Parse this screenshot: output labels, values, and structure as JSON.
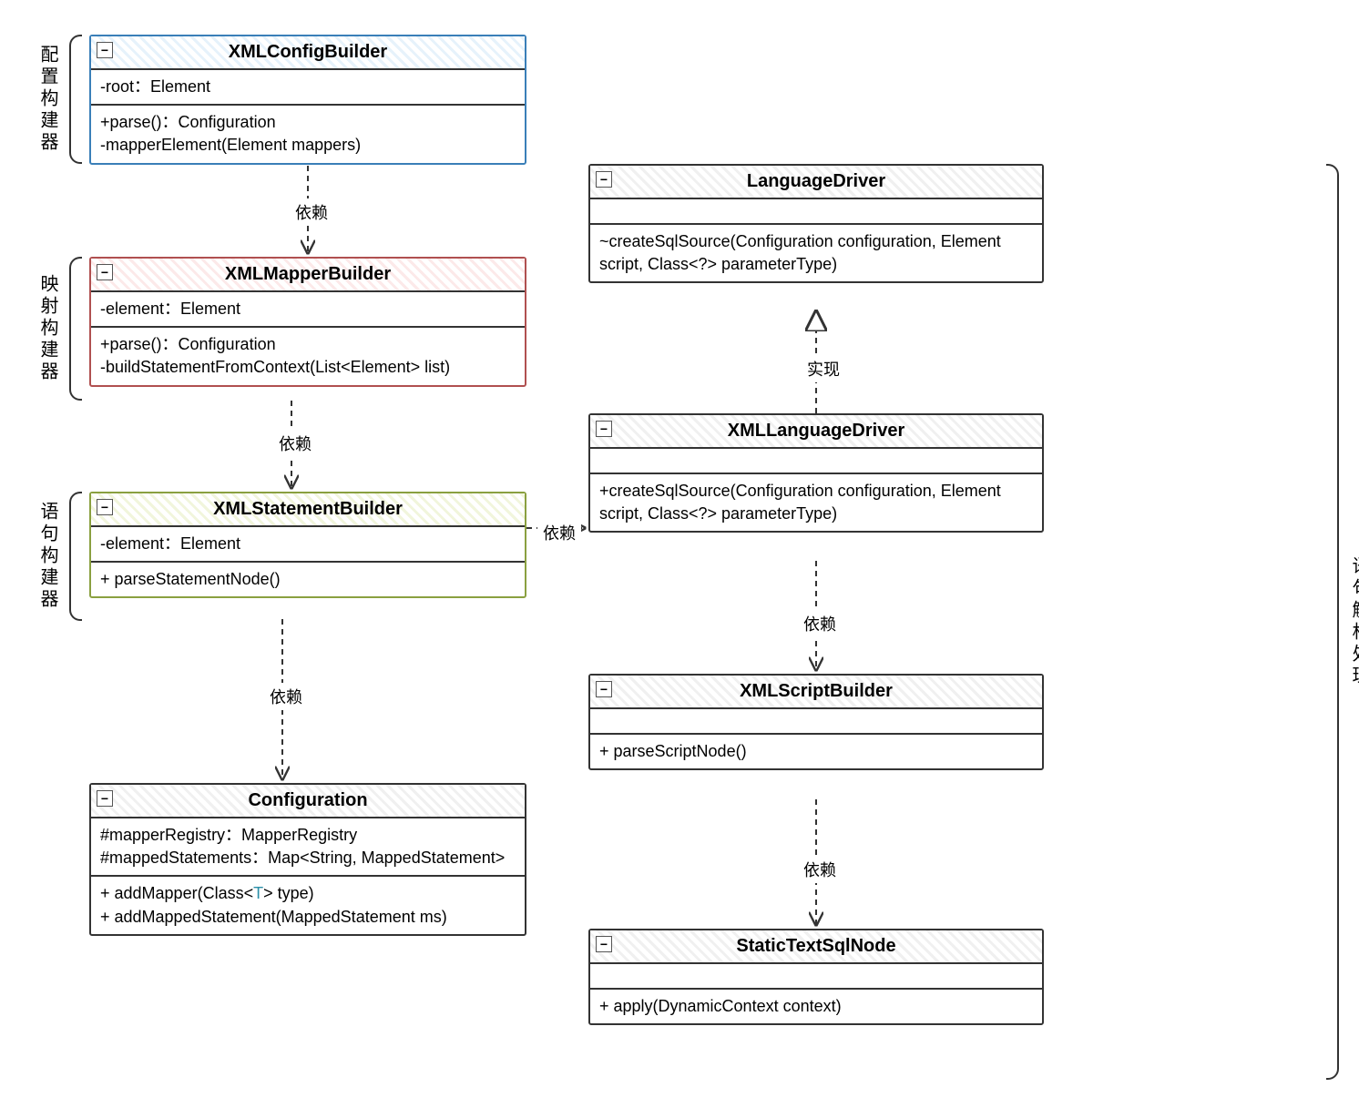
{
  "labels": {
    "group1": "配置构建器",
    "group2": "映射构建器",
    "group3": "语句构建器",
    "group4": "语句解析处理",
    "depend": "依赖",
    "realize": "实现"
  },
  "classes": {
    "xmlConfigBuilder": {
      "name": "XMLConfigBuilder",
      "attrs": "-root：Element",
      "ops1": "+parse()：Configuration",
      "ops2": "-mapperElement(Element mappers)"
    },
    "xmlMapperBuilder": {
      "name": "XMLMapperBuilder",
      "attrs": "-element：Element",
      "ops1": "+parse()：Configuration",
      "ops2": "-buildStatementFromContext(List<Element> list)"
    },
    "xmlStatementBuilder": {
      "name": "XMLStatementBuilder",
      "attrs": "-element：Element",
      "ops1": "+ parseStatementNode()"
    },
    "configuration": {
      "name": "Configuration",
      "attrs1": "#mapperRegistry：MapperRegistry",
      "attrs2": "#mappedStatements：Map<String, MappedStatement>",
      "ops1_pre": "+ addMapper(Class<",
      "ops1_t": "T",
      "ops1_post": "> type)",
      "ops2": "+ addMappedStatement(MappedStatement ms)"
    },
    "languageDriver": {
      "name": "LanguageDriver",
      "ops1": "~createSqlSource(Configuration configuration, Element script, Class<?> parameterType)"
    },
    "xmlLanguageDriver": {
      "name": "XMLLanguageDriver",
      "ops1": "+createSqlSource(Configuration configuration, Element script, Class<?> parameterType)"
    },
    "xmlScriptBuilder": {
      "name": "XMLScriptBuilder",
      "ops1": "+ parseScriptNode()"
    },
    "staticTextSqlNode": {
      "name": "StaticTextSqlNode",
      "ops1": "+ apply(DynamicContext context)"
    }
  }
}
